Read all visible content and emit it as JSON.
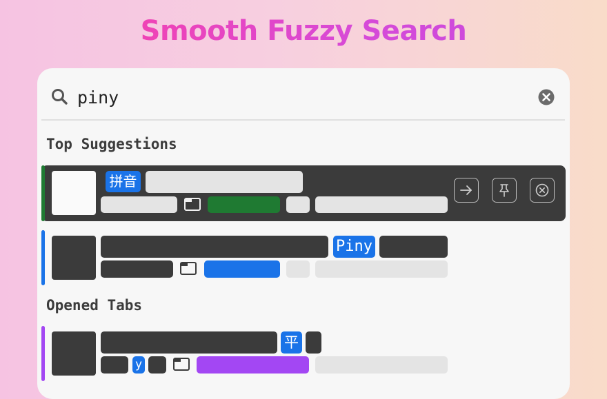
{
  "headline": "Smooth Fuzzy Search",
  "search": {
    "value": "piny",
    "placeholder": ""
  },
  "sections": {
    "top_suggestions": "Top Suggestions",
    "opened_tabs": "Opened Tabs"
  },
  "results": [
    {
      "highlight": "拼音",
      "accent_color": "#1f7a32",
      "selected": true
    },
    {
      "highlight": "Piny",
      "accent_color": "#1a73e8",
      "selected": false
    },
    {
      "highlight_title": "平",
      "highlight_url": "y",
      "accent_color": "#a347f3",
      "selected": false
    }
  ],
  "actions": [
    "arrow-right-icon",
    "pin-icon",
    "close-circle-icon"
  ],
  "colors": {
    "green": "#1f7a32",
    "blue": "#1a73e8",
    "purple": "#a347f3",
    "selected_row": "#3b3b3b"
  }
}
